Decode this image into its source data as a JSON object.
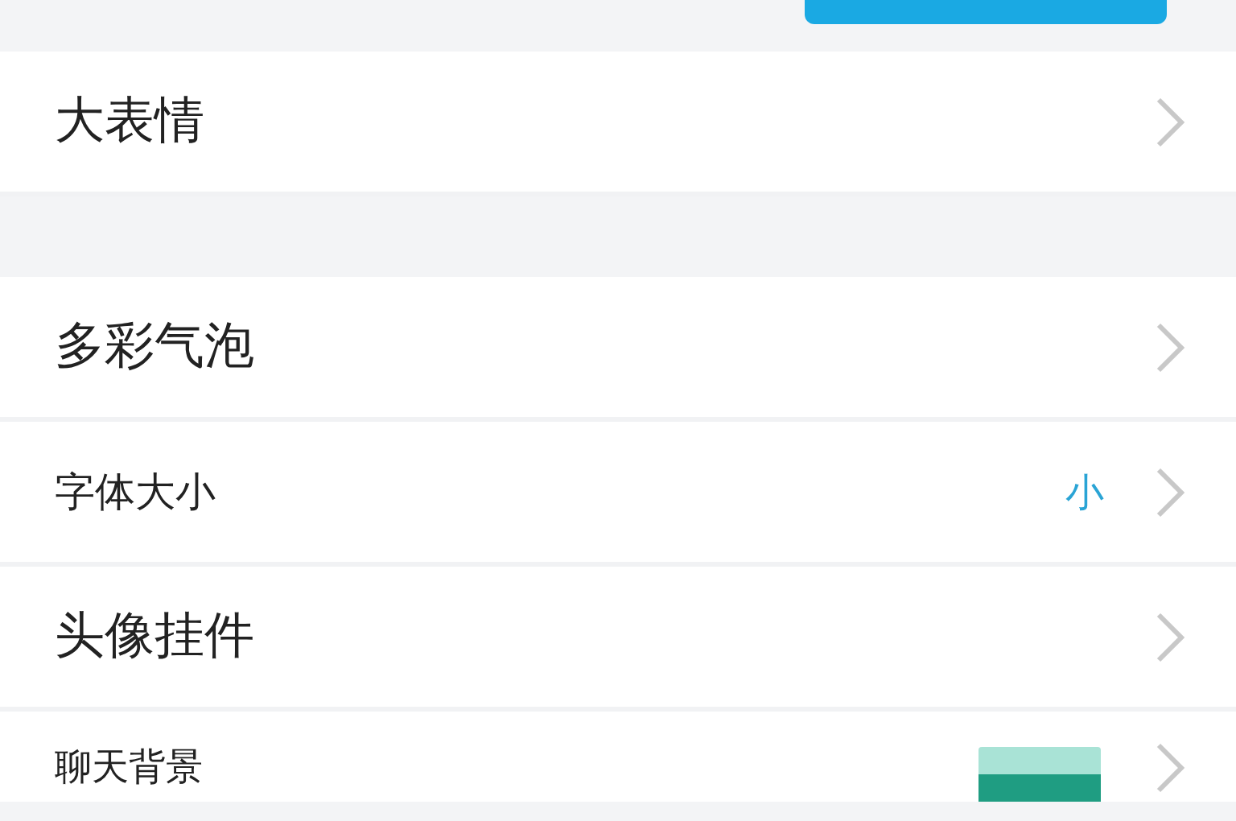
{
  "top_action": {
    "shown": true
  },
  "groups": [
    {
      "items": [
        {
          "kind": "plain",
          "label": "大表情"
        }
      ]
    },
    {
      "items": [
        {
          "kind": "plain",
          "label": "多彩气泡"
        },
        {
          "kind": "value",
          "label": "字体大小",
          "value": "小"
        },
        {
          "kind": "plain",
          "label": "头像挂件"
        },
        {
          "kind": "thumbnail",
          "label": "聊天背景"
        }
      ]
    }
  ]
}
